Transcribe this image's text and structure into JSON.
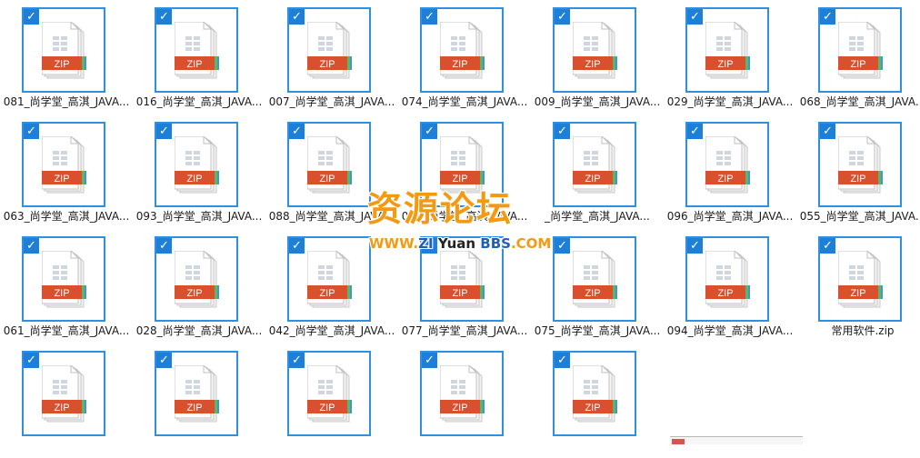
{
  "files": [
    {
      "name": "081_尚学堂_高淇_JAVA...",
      "icon_label": "ZIP",
      "selected": true
    },
    {
      "name": "016_尚学堂_高淇_JAVA...",
      "icon_label": "ZIP",
      "selected": true
    },
    {
      "name": "007_尚学堂_高淇_JAVA...",
      "icon_label": "ZIP",
      "selected": true
    },
    {
      "name": "074_尚学堂_高淇_JAVA...",
      "icon_label": "ZIP",
      "selected": true
    },
    {
      "name": "009_尚学堂_高淇_JAVA...",
      "icon_label": "ZIP",
      "selected": true
    },
    {
      "name": "029_尚学堂_高淇_JAVA...",
      "icon_label": "ZIP",
      "selected": true
    },
    {
      "name": "068_尚学堂_高淇_JAVA...",
      "icon_label": "ZIP",
      "selected": true
    },
    {
      "name": "063_尚学堂_高淇_JAVA...",
      "icon_label": "ZIP",
      "selected": true
    },
    {
      "name": "093_尚学堂_高淇_JAVA...",
      "icon_label": "ZIP",
      "selected": true
    },
    {
      "name": "088_尚学堂_高淇_JAVA...",
      "icon_label": "ZIP",
      "selected": true
    },
    {
      "name": "086_尚学堂_高淇_JAVA...",
      "icon_label": "ZIP",
      "selected": true
    },
    {
      "name": "_尚学堂_高淇_JAVA...",
      "icon_label": "ZIP",
      "selected": true
    },
    {
      "name": "096_尚学堂_高淇_JAVA...",
      "icon_label": "ZIP",
      "selected": true
    },
    {
      "name": "055_尚学堂_高淇_JAVA...",
      "icon_label": "ZIP",
      "selected": true
    },
    {
      "name": "061_尚学堂_高淇_JAVA...",
      "icon_label": "ZIP",
      "selected": true
    },
    {
      "name": "028_尚学堂_高淇_JAVA...",
      "icon_label": "ZIP",
      "selected": true
    },
    {
      "name": "042_尚学堂_高淇_JAVA...",
      "icon_label": "ZIP",
      "selected": true
    },
    {
      "name": "077_尚学堂_高淇_JAVA...",
      "icon_label": "ZIP",
      "selected": true
    },
    {
      "name": "075_尚学堂_高淇_JAVA...",
      "icon_label": "ZIP",
      "selected": true
    },
    {
      "name": "094_尚学堂_高淇_JAVA...",
      "icon_label": "ZIP",
      "selected": true
    },
    {
      "name": "常用软件.zip",
      "icon_label": "ZIP",
      "selected": true
    },
    {
      "name": "",
      "icon_label": "ZIP",
      "selected": true
    },
    {
      "name": "",
      "icon_label": "ZIP",
      "selected": true
    },
    {
      "name": "",
      "icon_label": "ZIP",
      "selected": true
    },
    {
      "name": "",
      "icon_label": "ZIP",
      "selected": true
    },
    {
      "name": "",
      "icon_label": "ZIP",
      "selected": true
    }
  ],
  "watermark": {
    "title": "资源论坛",
    "url_prefix": "WWW.",
    "url_zi": "ZI",
    "url_yuan": " Yuan ",
    "url_bbs": "BBS",
    "url_suffix": ".COM"
  },
  "colors": {
    "selection_border": "#2f8fe0",
    "check_bg": "#1e7fd9",
    "zip_red": "#d9502f",
    "zip_stripe_green": "#5cb85c",
    "zip_stripe_blue": "#4a90d9",
    "watermark_orange": "#f39a12",
    "watermark_blue": "#1f5fb8"
  }
}
